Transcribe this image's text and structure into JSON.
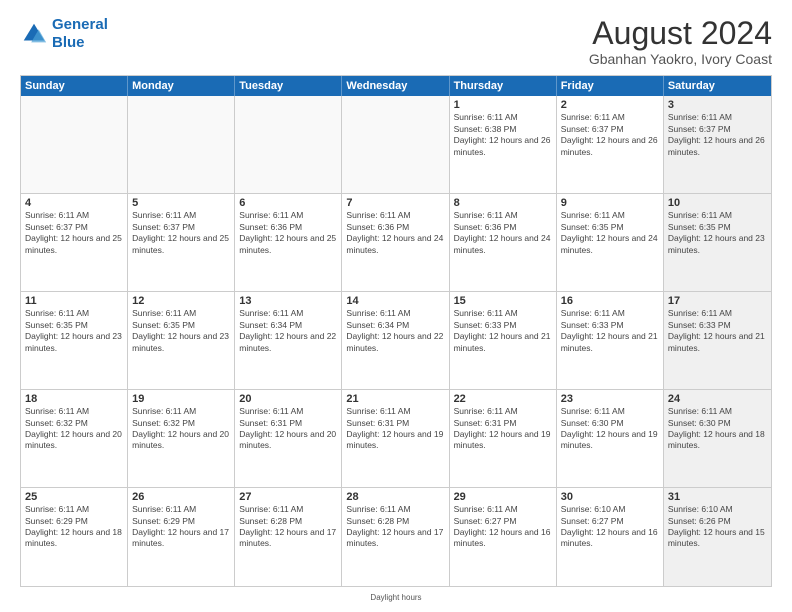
{
  "header": {
    "logo_line1": "General",
    "logo_line2": "Blue",
    "main_title": "August 2024",
    "subtitle": "Gbanhan Yaokro, Ivory Coast"
  },
  "calendar": {
    "days_of_week": [
      "Sunday",
      "Monday",
      "Tuesday",
      "Wednesday",
      "Thursday",
      "Friday",
      "Saturday"
    ],
    "weeks": [
      [
        {
          "day": "",
          "empty": true
        },
        {
          "day": "",
          "empty": true
        },
        {
          "day": "",
          "empty": true
        },
        {
          "day": "",
          "empty": true
        },
        {
          "day": "1",
          "sunrise": "6:11 AM",
          "sunset": "6:38 PM",
          "daylight": "12 hours and 26 minutes."
        },
        {
          "day": "2",
          "sunrise": "6:11 AM",
          "sunset": "6:37 PM",
          "daylight": "12 hours and 26 minutes."
        },
        {
          "day": "3",
          "sunrise": "6:11 AM",
          "sunset": "6:37 PM",
          "daylight": "12 hours and 26 minutes.",
          "shaded": true
        }
      ],
      [
        {
          "day": "4",
          "sunrise": "6:11 AM",
          "sunset": "6:37 PM",
          "daylight": "12 hours and 25 minutes."
        },
        {
          "day": "5",
          "sunrise": "6:11 AM",
          "sunset": "6:37 PM",
          "daylight": "12 hours and 25 minutes."
        },
        {
          "day": "6",
          "sunrise": "6:11 AM",
          "sunset": "6:36 PM",
          "daylight": "12 hours and 25 minutes."
        },
        {
          "day": "7",
          "sunrise": "6:11 AM",
          "sunset": "6:36 PM",
          "daylight": "12 hours and 24 minutes."
        },
        {
          "day": "8",
          "sunrise": "6:11 AM",
          "sunset": "6:36 PM",
          "daylight": "12 hours and 24 minutes."
        },
        {
          "day": "9",
          "sunrise": "6:11 AM",
          "sunset": "6:35 PM",
          "daylight": "12 hours and 24 minutes."
        },
        {
          "day": "10",
          "sunrise": "6:11 AM",
          "sunset": "6:35 PM",
          "daylight": "12 hours and 23 minutes.",
          "shaded": true
        }
      ],
      [
        {
          "day": "11",
          "sunrise": "6:11 AM",
          "sunset": "6:35 PM",
          "daylight": "12 hours and 23 minutes."
        },
        {
          "day": "12",
          "sunrise": "6:11 AM",
          "sunset": "6:35 PM",
          "daylight": "12 hours and 23 minutes."
        },
        {
          "day": "13",
          "sunrise": "6:11 AM",
          "sunset": "6:34 PM",
          "daylight": "12 hours and 22 minutes."
        },
        {
          "day": "14",
          "sunrise": "6:11 AM",
          "sunset": "6:34 PM",
          "daylight": "12 hours and 22 minutes."
        },
        {
          "day": "15",
          "sunrise": "6:11 AM",
          "sunset": "6:33 PM",
          "daylight": "12 hours and 21 minutes."
        },
        {
          "day": "16",
          "sunrise": "6:11 AM",
          "sunset": "6:33 PM",
          "daylight": "12 hours and 21 minutes."
        },
        {
          "day": "17",
          "sunrise": "6:11 AM",
          "sunset": "6:33 PM",
          "daylight": "12 hours and 21 minutes.",
          "shaded": true
        }
      ],
      [
        {
          "day": "18",
          "sunrise": "6:11 AM",
          "sunset": "6:32 PM",
          "daylight": "12 hours and 20 minutes."
        },
        {
          "day": "19",
          "sunrise": "6:11 AM",
          "sunset": "6:32 PM",
          "daylight": "12 hours and 20 minutes."
        },
        {
          "day": "20",
          "sunrise": "6:11 AM",
          "sunset": "6:31 PM",
          "daylight": "12 hours and 20 minutes."
        },
        {
          "day": "21",
          "sunrise": "6:11 AM",
          "sunset": "6:31 PM",
          "daylight": "12 hours and 19 minutes."
        },
        {
          "day": "22",
          "sunrise": "6:11 AM",
          "sunset": "6:31 PM",
          "daylight": "12 hours and 19 minutes."
        },
        {
          "day": "23",
          "sunrise": "6:11 AM",
          "sunset": "6:30 PM",
          "daylight": "12 hours and 19 minutes."
        },
        {
          "day": "24",
          "sunrise": "6:11 AM",
          "sunset": "6:30 PM",
          "daylight": "12 hours and 18 minutes.",
          "shaded": true
        }
      ],
      [
        {
          "day": "25",
          "sunrise": "6:11 AM",
          "sunset": "6:29 PM",
          "daylight": "12 hours and 18 minutes."
        },
        {
          "day": "26",
          "sunrise": "6:11 AM",
          "sunset": "6:29 PM",
          "daylight": "12 hours and 17 minutes."
        },
        {
          "day": "27",
          "sunrise": "6:11 AM",
          "sunset": "6:28 PM",
          "daylight": "12 hours and 17 minutes."
        },
        {
          "day": "28",
          "sunrise": "6:11 AM",
          "sunset": "6:28 PM",
          "daylight": "12 hours and 17 minutes."
        },
        {
          "day": "29",
          "sunrise": "6:11 AM",
          "sunset": "6:27 PM",
          "daylight": "12 hours and 16 minutes."
        },
        {
          "day": "30",
          "sunrise": "6:10 AM",
          "sunset": "6:27 PM",
          "daylight": "12 hours and 16 minutes."
        },
        {
          "day": "31",
          "sunrise": "6:10 AM",
          "sunset": "6:26 PM",
          "daylight": "12 hours and 15 minutes.",
          "shaded": true
        }
      ]
    ],
    "daylight_note": "Daylight hours"
  }
}
